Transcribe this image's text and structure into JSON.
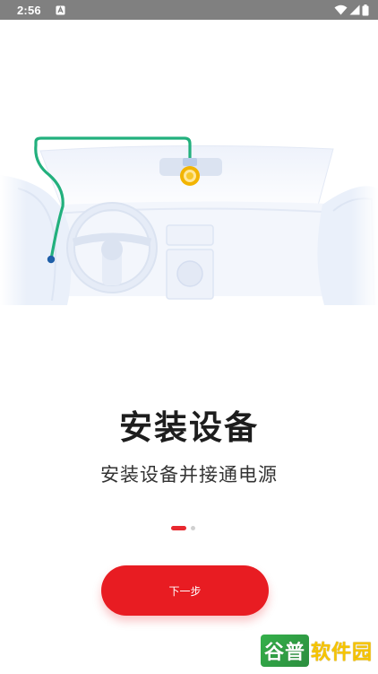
{
  "status_bar": {
    "time": "2:56",
    "icons": [
      "notification-icon",
      "wifi-icon",
      "signal-icon",
      "battery-icon"
    ]
  },
  "onboarding": {
    "title": "安装设备",
    "subtitle": "安装设备并接通电源",
    "page_indicator": {
      "current": 1,
      "total": 2
    },
    "next_button_label": "下一步"
  },
  "watermark": {
    "part1": "谷普",
    "part2": "软件园"
  },
  "colors": {
    "accent": "#e81c22",
    "cable": "#22b07d",
    "illustration": "#e6ecf7"
  }
}
